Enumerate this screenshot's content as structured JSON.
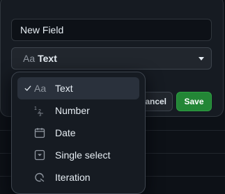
{
  "dialog": {
    "field_name_value": "New Field",
    "type_select": {
      "prefix": "Aa",
      "value": "Text"
    },
    "cancel_label": "ancel",
    "save_label": "Save"
  },
  "type_menu": {
    "items": [
      {
        "label": "Text",
        "icon": "text-aa-icon",
        "icon_text": "Aa",
        "selected": true
      },
      {
        "label": "Number",
        "icon": "number-icon",
        "icon_text": "1 2/3",
        "selected": false
      },
      {
        "label": "Date",
        "icon": "calendar-icon",
        "selected": false
      },
      {
        "label": "Single select",
        "icon": "single-select-icon",
        "selected": false
      },
      {
        "label": "Iteration",
        "icon": "iteration-icon",
        "selected": false
      }
    ]
  },
  "colors": {
    "background": "#0d1117",
    "panel": "#161b22",
    "save_green": "#238636",
    "selected_row": "#2a313c"
  }
}
